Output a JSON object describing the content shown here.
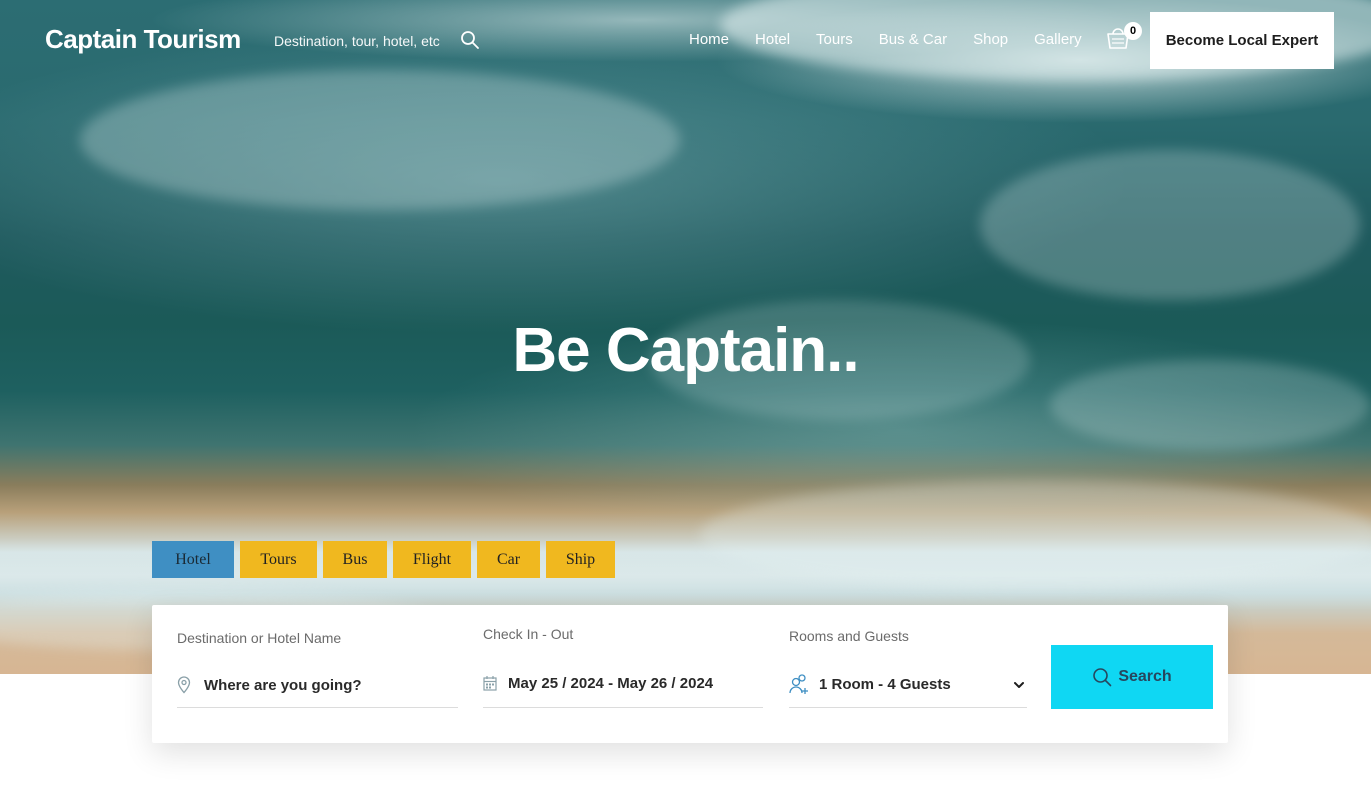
{
  "header": {
    "brand": "Captain Tourism",
    "search_placeholder": "Destination, tour, hotel, etc",
    "nav": [
      "Home",
      "Hotel",
      "Tours",
      "Bus & Car",
      "Shop",
      "Gallery"
    ],
    "cart_count": "0",
    "cta_label": "Become Local Expert"
  },
  "hero": {
    "title": "Be Captain.."
  },
  "booking": {
    "tabs": [
      "Hotel",
      "Tours",
      "Bus",
      "Flight",
      "Car",
      "Ship"
    ],
    "active_tab": "Hotel",
    "destination": {
      "label": "Destination or Hotel Name",
      "placeholder": "Where are you going?"
    },
    "dates": {
      "label": "Check In - Out",
      "value": "May 25 / 2024 - May 26 / 2024"
    },
    "rooms": {
      "label": "Rooms and Guests",
      "value": "1 Room - 4 Guests"
    },
    "search_label": "Search"
  },
  "colors": {
    "tab_active": "#3f8fc3",
    "tab_inactive": "#f0b81f",
    "search_button": "#0fd7f3",
    "cta_bg": "#ffffff"
  },
  "icons": [
    "search-icon",
    "cart-icon",
    "location-pin-icon",
    "calendar-icon",
    "guests-icon",
    "chevron-down-icon"
  ]
}
